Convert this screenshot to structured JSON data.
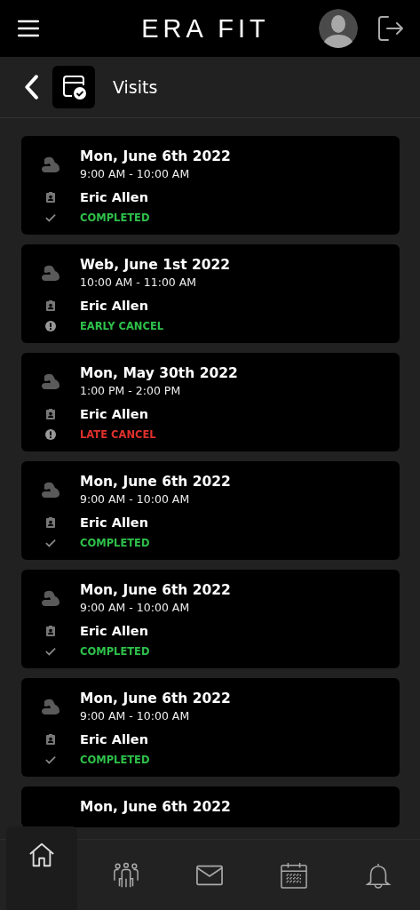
{
  "header": {
    "logo": "ERA FIT"
  },
  "subheader": {
    "title": "Visits"
  },
  "visits": [
    {
      "date": "Mon, June 6th 2022",
      "time": "9:00 AM - 10:00 AM",
      "trainer": "Eric Allen",
      "status": "COMPLETED",
      "kind": "check",
      "color": "#2ec04a"
    },
    {
      "date": "Web, June 1st 2022",
      "time": "10:00 AM - 11:00 AM",
      "trainer": "Eric Allen",
      "status": "EARLY CANCEL",
      "kind": "alert",
      "color": "#2ec04a"
    },
    {
      "date": "Mon, May 30th 2022",
      "time": "1:00 PM - 2:00 PM",
      "trainer": "Eric Allen",
      "status": "LATE CANCEL",
      "kind": "alert",
      "color": "#e0302c"
    },
    {
      "date": "Mon, June 6th 2022",
      "time": "9:00 AM - 10:00 AM",
      "trainer": "Eric Allen",
      "status": "COMPLETED",
      "kind": "check",
      "color": "#2ec04a"
    },
    {
      "date": "Mon, June 6th 2022",
      "time": "9:00 AM - 10:00 AM",
      "trainer": "Eric Allen",
      "status": "COMPLETED",
      "kind": "check",
      "color": "#2ec04a"
    },
    {
      "date": "Mon, June 6th 2022",
      "time": "9:00 AM - 10:00 AM",
      "trainer": "Eric Allen",
      "status": "COMPLETED",
      "kind": "check",
      "color": "#2ec04a"
    },
    {
      "date": "Mon, June 6th 2022"
    }
  ],
  "nav": [
    {
      "kind": "home",
      "selected": true
    },
    {
      "kind": "people",
      "selected": false
    },
    {
      "kind": "mail",
      "selected": false
    },
    {
      "kind": "calendar",
      "selected": false
    },
    {
      "kind": "bell",
      "selected": false
    }
  ]
}
